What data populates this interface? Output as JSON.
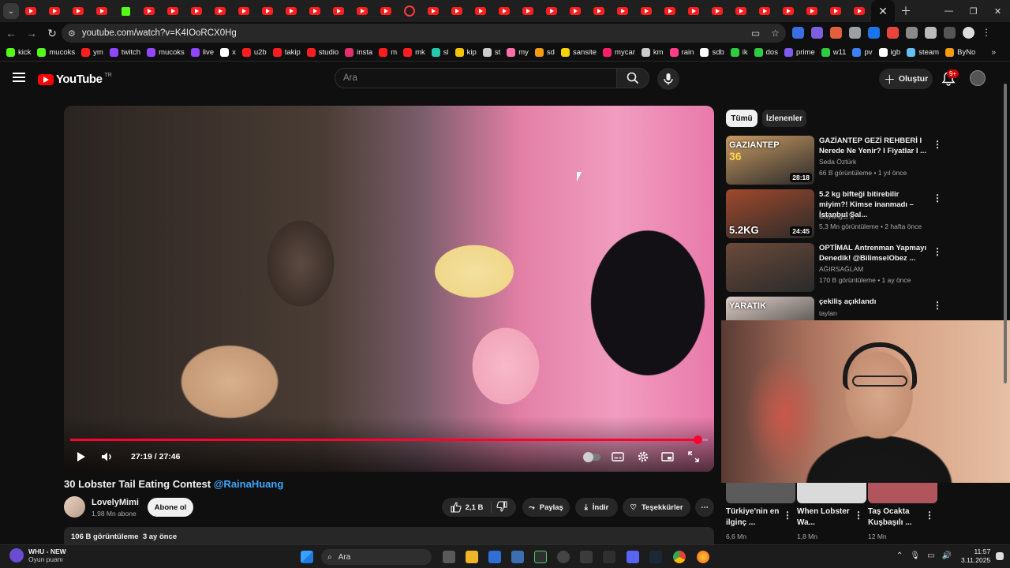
{
  "browser": {
    "url": "youtube.com/watch?v=K4IOoRCX0Hg",
    "bookmarks": [
      "kick",
      "mucoks",
      "ym",
      "twitch",
      "mucoks",
      "live",
      "x",
      "u2b",
      "takip",
      "studio",
      "insta",
      "m",
      "mk",
      "sl",
      "kip",
      "st",
      "my",
      "sd",
      "sansite",
      "mycar",
      "km",
      "rain",
      "sdb",
      "ik",
      "dos",
      "prime",
      "w11",
      "pv",
      "igb",
      "steam",
      "ByNo"
    ],
    "bookmark_colors": [
      "#53fc18",
      "#53fc18",
      "#ff1e1e",
      "#9146ff",
      "#9146ff",
      "#9146ff",
      "#ffffff",
      "#ff1e1e",
      "#ff1e1e",
      "#ff1e1e",
      "#e1306c",
      "#ff1e1e",
      "#ff1e1e",
      "#24c8b0",
      "#f5c400",
      "#cccccc",
      "#ff6fa8",
      "#f39c12",
      "#f5d400",
      "#ff1e6e",
      "#cccccc",
      "#ff3e8a",
      "#ffffff",
      "#2ecc40",
      "#2ecc40",
      "#7f5af0",
      "#2ecc40",
      "#3b82f6",
      "#ffffff",
      "#66c0f4",
      "#f39c12"
    ]
  },
  "yt": {
    "logo_word": "YouTube",
    "logo_country": "TR",
    "search_placeholder": "Ara",
    "create_label": "Oluştur",
    "notif_count": "9+"
  },
  "player": {
    "time": "27:19 / 27:46",
    "progress": 0.984
  },
  "video": {
    "title": "30 Lobster Tail Eating Contest",
    "title_tag": "@RainaHuang",
    "channel": "LovelyMimi",
    "subs": "1,98 Mn abone",
    "subscribe": "Abone ol",
    "likes": "2,1 B",
    "share": "Paylaş",
    "download": "İndir",
    "thanks": "Teşekkürler",
    "views": "106 B görüntüleme",
    "age": "3 ay önce"
  },
  "sidebar": {
    "chips": [
      "Tümü",
      "İzlenenler"
    ],
    "recs": [
      {
        "title": "GAZİANTEP GEZİ REHBERİ I Nerede Ne Yenir? I Fiyatlar I ...",
        "channel": "Seda Öztürk",
        "meta": "66 B görüntüleme • 1 yıl önce",
        "duration": "28:18",
        "thumb": "#c99a62",
        "label": "GAZIANTEP",
        "num": "36"
      },
      {
        "title": "5.2 kg bifteği bitirebilir miyim?! Kimse inanmadı – İstanbul Sal...",
        "channel": "tzuyang쯔양",
        "meta": "5,3 Mn görüntüleme • 2 hafta önce",
        "duration": "24:45",
        "thumb": "#a0492c",
        "label": "5.2KG"
      },
      {
        "title": "OPTİMAL Antrenman Yapmayı Denedik! @BilimselObez ...",
        "channel": "AĞIRSAĞLAM",
        "meta": "170 B görüntüleme • 1 ay önce",
        "duration": "",
        "thumb": "#6b4a3a",
        "label": ""
      },
      {
        "title": "çekiliş açıklandı",
        "channel": "tayları",
        "meta": "",
        "duration": "",
        "thumb": "#e0d0c8",
        "label": "YARATIK"
      }
    ],
    "shorts": [
      {
        "title": "Türkiye'nin en ilginç ...",
        "meta": "6,6 Mn",
        "bg": "#5b5b5b"
      },
      {
        "title": "When Lobster Wa...",
        "meta": "1,8 Mn",
        "bg": "#dadada"
      },
      {
        "title": "Taş Ocakta Kuşbaşılı ...",
        "meta": "12 Mn",
        "bg": "#b0555b"
      }
    ]
  },
  "taskbar": {
    "widget_title": "WHU - NEW",
    "widget_sub": "Oyun puanı",
    "search": "Ara",
    "time": "11:57",
    "date": "3.11.2025"
  }
}
